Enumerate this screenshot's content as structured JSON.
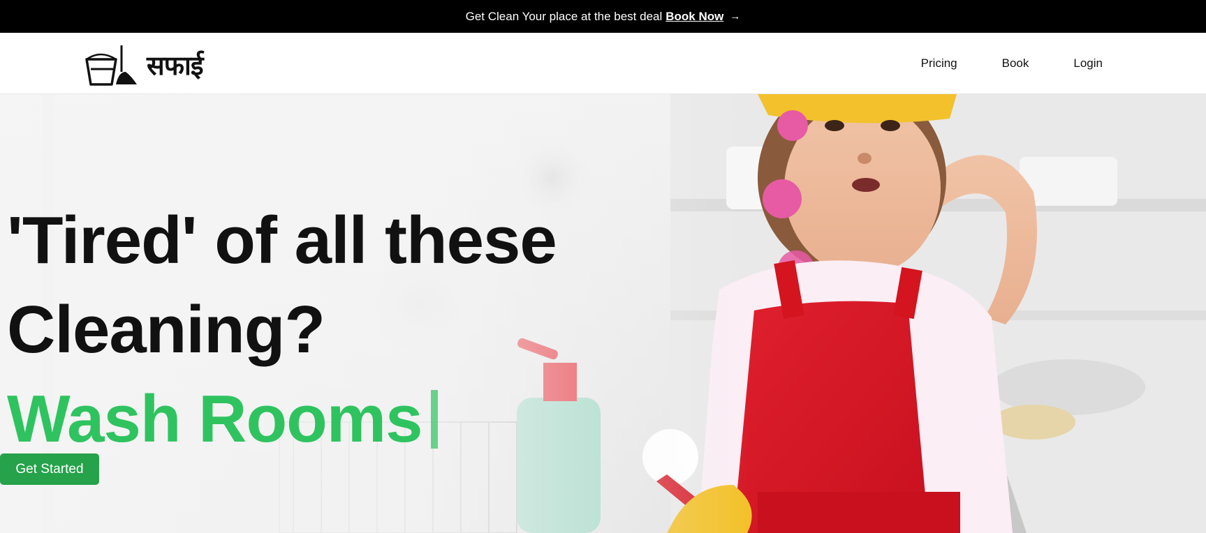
{
  "announcement": {
    "text": "Get Clean Your place at the best deal",
    "link_label": "Book Now",
    "arrow": "→"
  },
  "navbar": {
    "logo_text": "सफाई",
    "logo_icon": "bucket-broom-icon",
    "links": [
      {
        "label": "Pricing"
      },
      {
        "label": "Book"
      },
      {
        "label": "Login"
      }
    ]
  },
  "hero": {
    "headline_line1": "'Tired' of all these",
    "headline_line2": "Cleaning?",
    "typed_text": "Wash Rooms",
    "cta_label": "Get Started",
    "background": "girl-in-red-apron-cleaning-kitchen-photo"
  },
  "colors": {
    "announcement_bg": "#000000",
    "accent_green": "#2fc35f",
    "cta_green": "#25a24a",
    "text_dark": "#111111"
  }
}
